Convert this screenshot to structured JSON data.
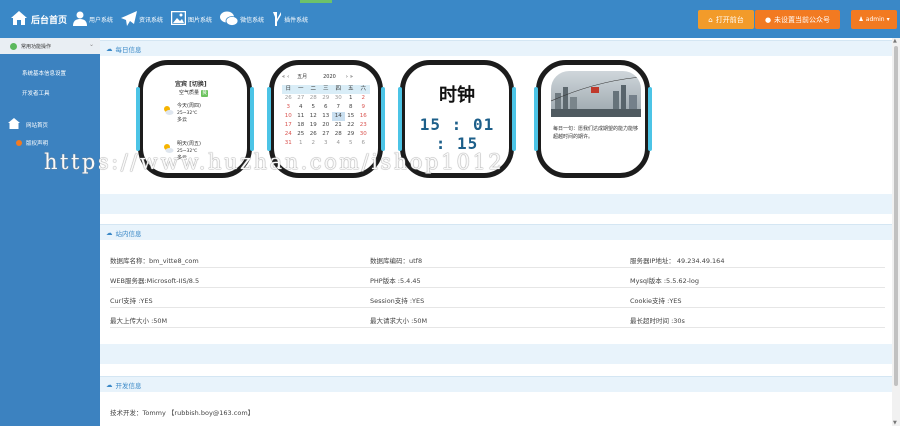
{
  "nav": {
    "home": "后台首页",
    "items": [
      "用户系统",
      "资讯系统",
      "图片系统",
      "微信系统",
      "插件系统"
    ],
    "open_front": "打开前台",
    "mp_status": "未设置当前公众号",
    "admin": "admin"
  },
  "sidebar": {
    "header": "常用功能操作",
    "items": [
      "系统基本信息设置",
      "开发者工具"
    ],
    "group": "网站首页",
    "group_item": "版权声明"
  },
  "daily": {
    "title": "每日信息",
    "weather": {
      "city": "宜宾 [切换]",
      "aqi_label": "空气质量",
      "aqi_value": "良",
      "today": {
        "label": "今天(周四)",
        "temp": "25~32℃",
        "desc": "多云"
      },
      "tomorrow": {
        "label": "明天(周五)",
        "temp": "25~32℃",
        "desc": "多云"
      }
    },
    "calendar": {
      "month": "五月",
      "year": "2020",
      "weekdays": [
        "日",
        "一",
        "二",
        "三",
        "四",
        "五",
        "六"
      ],
      "days": [
        [
          "26",
          "27",
          "28",
          "29",
          "30",
          "1",
          "2"
        ],
        [
          "3",
          "4",
          "5",
          "6",
          "7",
          "8",
          "9"
        ],
        [
          "10",
          "11",
          "12",
          "13",
          "14",
          "15",
          "16"
        ],
        [
          "17",
          "18",
          "19",
          "20",
          "21",
          "22",
          "23"
        ],
        [
          "24",
          "25",
          "26",
          "27",
          "28",
          "29",
          "30"
        ],
        [
          "31",
          "1",
          "2",
          "3",
          "4",
          "5",
          "6"
        ]
      ],
      "today": "14"
    },
    "clock": {
      "title": "时钟",
      "time": "15 : 01 : 15"
    },
    "quote": "每日一句：愿我们达成期望的能力能够超越时间的期许。"
  },
  "site": {
    "title": "站内信息",
    "rows": [
      [
        "数据库名称：bm_vitte8_com",
        "数据库编码：utf8",
        "服务器IP地址： 49.234.49.164"
      ],
      [
        "WEB服务器:Microsoft-IIS/8.5",
        "PHP版本 :5.4.45",
        "Mysql版本 :5.5.62-log"
      ],
      [
        "Curl支持 :YES",
        "Session支持 :YES",
        "Cookie支持 :YES"
      ],
      [
        "最大上传大小 :50M",
        "最大请求大小 :50M",
        "最长超时时间 :30s"
      ]
    ]
  },
  "dev": {
    "title": "开发信息",
    "line": "技术开发：Tommy 【rubbish.boy@163.com】"
  },
  "watermark": "https://www.huzhan.com/ishop1012",
  "colors": {
    "topbar": "#3a88c7",
    "accent_orange": "#f27a21",
    "frame_cyan": "#4cc4e6"
  }
}
